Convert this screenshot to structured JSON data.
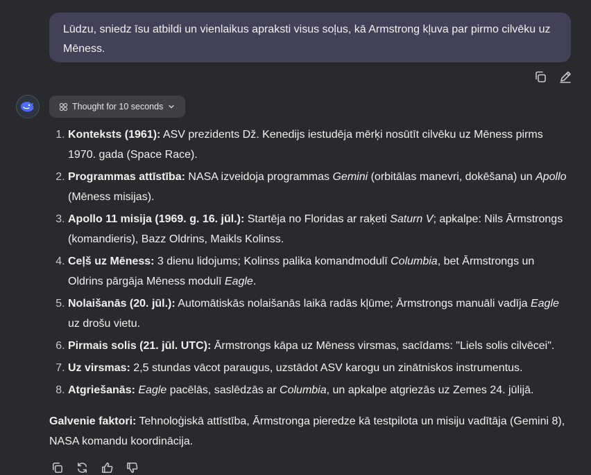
{
  "user_message": "Lūdzu, sniedz īsu atbildi un vienlaikus apraksti visus soļus, kā Armstrong kļuva par pirmo cilvēku uz Mēness.",
  "thought_label": "Thought for 10 seconds",
  "steps": [
    {
      "bold": "Konteksts (1961):",
      "parts": [
        " ASV prezidents Dž. Kenedijs iestudēja mērķi nosūtīt cilvēku uz Mēness pirms 1970. gada (Space Race)."
      ]
    },
    {
      "bold": "Programmas attīstība:",
      "parts": [
        " NASA izveidoja programmas ",
        "Gemini",
        " (orbitālas manevri, dokēšana) un ",
        "Apollo",
        " (Mēness misijas)."
      ]
    },
    {
      "bold": "Apollo 11 misija (1969. g. 16. jūl.):",
      "parts": [
        " Startēja no Floridas ar raķeti ",
        "Saturn V",
        "; apkalpe: Nils Ārmstrongs (komandieris), Bazz Oldrins, Maikls Kolinss."
      ]
    },
    {
      "bold": "Ceļš uz Mēness:",
      "parts": [
        " 3 dienu lidojums; Kolinss palika komandmodulī ",
        "Columbia",
        ", bet Ārmstrongs un Oldrins pārgāja Mēness modulī ",
        "Eagle",
        "."
      ]
    },
    {
      "bold": "Nolaišanās (20. jūl.):",
      "parts": [
        " Automātiskās nolaišanās laikā radās kļūme; Ārmstrongs manuāli vadīja ",
        "Eagle",
        " uz drošu vietu."
      ]
    },
    {
      "bold": "Pirmais solis (21. jūl. UTC):",
      "parts": [
        " Ārmstrongs kāpa uz Mēness virsmas, sacīdams: \"Liels solis cilvēcei\"."
      ]
    },
    {
      "bold": "Uz virsmas:",
      "parts": [
        " 2,5 stundas vācot paraugus, uzstādot ASV karogu un zinātniskos instrumentus."
      ]
    },
    {
      "bold": "Atgriešanās:",
      "parts": [
        " ",
        "Eagle",
        " pacēlās, saslēdzās ar ",
        "Columbia",
        ", un apkalpe atgriezās uz Zemes 24. jūlijā."
      ]
    }
  ],
  "summary": {
    "bold": "Galvenie faktori:",
    "text": " Tehnoloģiskā attīstība, Ārmstronga pieredze kā testpilota un misiju vadītāja (Gemini 8), NASA komandu koordinācija."
  },
  "icons": {
    "user_actions": [
      "copy-icon",
      "edit-icon"
    ],
    "answer_actions": [
      "copy-icon",
      "regenerate-icon",
      "thumbs-up-icon",
      "thumbs-down-icon"
    ],
    "thought": "brain-icon",
    "avatar": "whale-logo"
  },
  "colors": {
    "background": "#292a2d",
    "user_bubble": "#414158",
    "thought_button": "#3f4043",
    "logo": "#4d6bfe"
  }
}
